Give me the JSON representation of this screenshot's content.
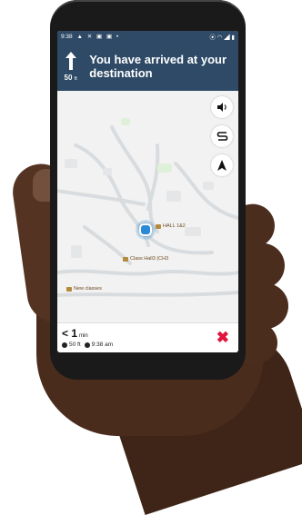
{
  "status_bar": {
    "time": "9:38",
    "left_icons": [
      "navigation-icon",
      "x-icon",
      "app-icon",
      "app-icon",
      "dot-icon"
    ],
    "right_icons": [
      "location-icon",
      "wifi-icon",
      "signal-icon",
      "battery-icon"
    ]
  },
  "nav": {
    "distance_value": "50",
    "distance_unit": "ft",
    "instruction": "You have arrived at your destination",
    "turn_icon": "arrow-up-icon"
  },
  "map": {
    "controls": [
      "volume-icon",
      "route-icon",
      "compass-icon"
    ],
    "pois": [
      {
        "label": "HALL 1&2"
      },
      {
        "label": "Class Hall3 (CH3"
      },
      {
        "label": "New classes"
      }
    ]
  },
  "footer": {
    "eta_prefix": "<",
    "eta_value": "1",
    "eta_unit": "min",
    "distance": "50 ft",
    "arrival_time": "9:38 am",
    "close_label": "✖"
  },
  "colors": {
    "header_bg": "#2e4a66",
    "close_red": "#e0143c",
    "poi_brown": "#b48a3c"
  }
}
